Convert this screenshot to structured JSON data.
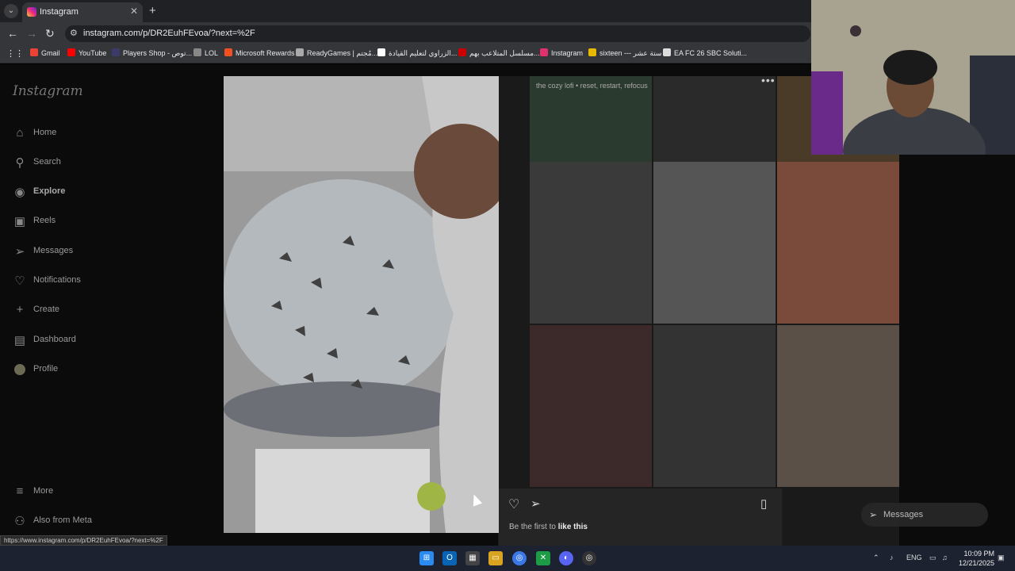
{
  "browser": {
    "tab_title": "Instagram",
    "url": "instagram.com/p/DR2EuhFEvoa/?next=%2F",
    "status_url": "https://www.instagram.com/p/DR2EuhFEvoa/?next=%2F",
    "bookmarks": [
      {
        "label": "Gmail",
        "color": "#ea4335"
      },
      {
        "label": "YouTube",
        "color": "#ff0000"
      },
      {
        "label": "Players Shop - توص...",
        "color": "#3b3b6b"
      },
      {
        "label": "LOL",
        "color": "#888888"
      },
      {
        "label": "Microsoft Rewards",
        "color": "#f25022"
      },
      {
        "label": "ReadyGames | مُجتم...",
        "color": "#aaaaaa"
      },
      {
        "label": "الزراوي لتعليم القيادة...",
        "color": "#ffffff"
      },
      {
        "label": "مسلسل المتلاعب بهم...",
        "color": "#cc0000"
      },
      {
        "label": "Instagram",
        "color": "#e1306c"
      },
      {
        "label": "sixteen --- ستة عشر",
        "color": "#e6b800"
      },
      {
        "label": "EA FC 26 SBC Soluti...",
        "color": "#dddddd"
      }
    ]
  },
  "sidebar": {
    "logo": "Instagram",
    "items": [
      {
        "label": "Home",
        "icon": "home-icon",
        "glyph": "⌂"
      },
      {
        "label": "Search",
        "icon": "search-icon",
        "glyph": "⚲"
      },
      {
        "label": "Explore",
        "icon": "explore-icon",
        "glyph": "◉"
      },
      {
        "label": "Reels",
        "icon": "reels-icon",
        "glyph": "▣"
      },
      {
        "label": "Messages",
        "icon": "messages-icon",
        "glyph": "➢"
      },
      {
        "label": "Notifications",
        "icon": "heart-icon",
        "glyph": "♡"
      },
      {
        "label": "Create",
        "icon": "plus-icon",
        "glyph": "+"
      },
      {
        "label": "Dashboard",
        "icon": "dashboard-icon",
        "glyph": "▤"
      },
      {
        "label": "Profile",
        "icon": "avatar-icon",
        "glyph": ""
      }
    ],
    "bottom": [
      {
        "label": "More",
        "icon": "menu-icon",
        "glyph": "≡"
      },
      {
        "label": "Also from Meta",
        "icon": "meta-icon",
        "glyph": "⚇"
      }
    ]
  },
  "post": {
    "caption": "the cozy lofi • reset, restart, refocus",
    "likes_prefix": "Be the first to ",
    "likes_action": "like this"
  },
  "messages_pill": {
    "label": "Messages"
  },
  "taskbar": {
    "lang": "ENG",
    "time": "10:09 PM",
    "date": "12/21/2025"
  }
}
